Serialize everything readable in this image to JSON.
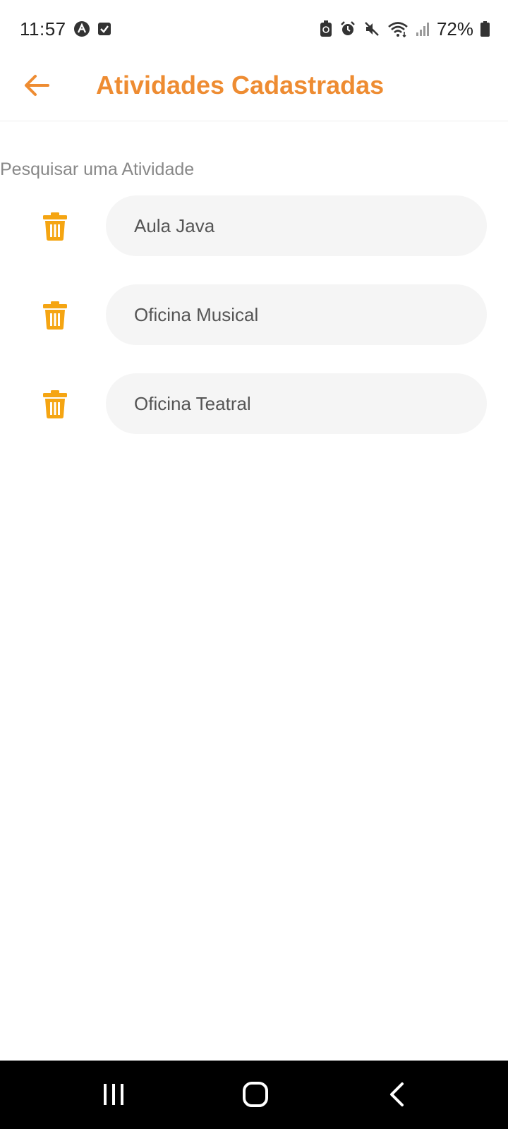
{
  "status_bar": {
    "time": "11:57",
    "battery_percent": "72%",
    "left_icons": [
      "app-notification-icon",
      "checkbox-notification-icon"
    ],
    "right_icons": [
      "battery-saver-icon",
      "alarm-icon",
      "mute-icon",
      "wifi-icon",
      "signal-icon",
      "battery-icon"
    ]
  },
  "app_bar": {
    "title": "Atividades Cadastradas",
    "back_icon": "arrow-left-icon"
  },
  "search": {
    "label": "Pesquisar uma Atividade"
  },
  "activities": [
    {
      "name": "Aula Java",
      "action_icon": "trash-icon"
    },
    {
      "name": "Oficina Musical",
      "action_icon": "trash-icon"
    },
    {
      "name": "Oficina Teatral",
      "action_icon": "trash-icon"
    }
  ],
  "nav_bar": {
    "buttons": [
      "recent-apps-icon",
      "home-icon",
      "back-icon"
    ]
  },
  "colors": {
    "accent": "#ee8c32",
    "trash": "#f5a512",
    "pill_bg": "#f5f5f5",
    "label_gray": "#888888"
  }
}
